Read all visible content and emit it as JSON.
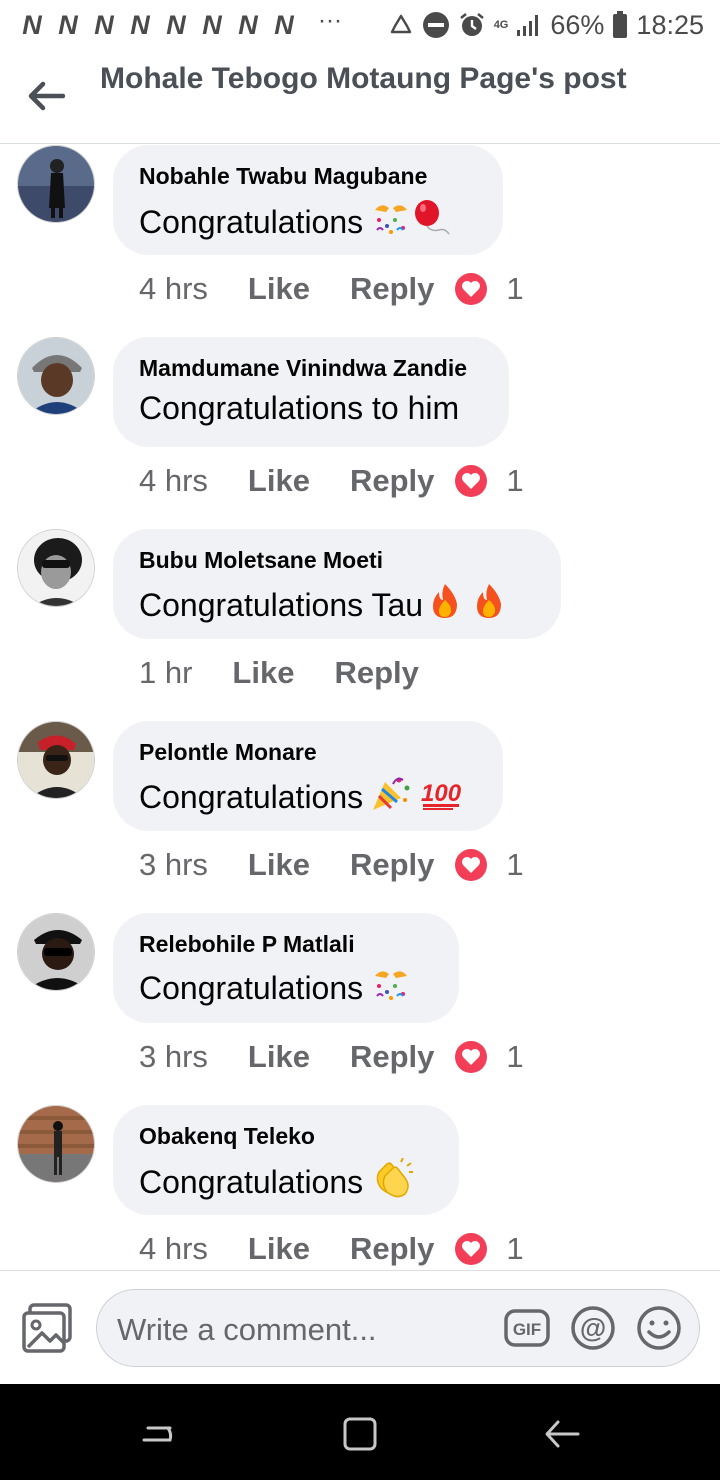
{
  "status_bar": {
    "notif_glyphs": [
      "N",
      "N",
      "N",
      "N",
      "N",
      "N",
      "N",
      "N"
    ],
    "overflow": "···",
    "network": "4G",
    "battery_pct": "66%",
    "time": "18:25",
    "icons": [
      "recycle-icon",
      "do-not-disturb-icon",
      "alarm-icon",
      "network-4g-icon",
      "signal-icon",
      "battery-icon"
    ]
  },
  "header": {
    "back_icon": "arrow-left-icon",
    "title": "Mohale Tebogo Motaung Page's post"
  },
  "comments": [
    {
      "author": "Nobahle Twabu Magubane",
      "text": "Congratulations",
      "emojis": [
        "confetti-icon",
        "balloon-icon"
      ],
      "time": "4 hrs",
      "like": "Like",
      "reply": "Reply",
      "reactions": "1",
      "has_reaction": true
    },
    {
      "author": "Mamdumane Vinindwa Zandie",
      "text": "Congratulations to him",
      "emojis": [],
      "time": "4 hrs",
      "like": "Like",
      "reply": "Reply",
      "reactions": "1",
      "has_reaction": true
    },
    {
      "author": "Bubu Moletsane Moeti",
      "text": "Congratulations Tau",
      "emojis": [
        "fire-icon",
        "fire-icon"
      ],
      "time": "1 hr",
      "like": "Like",
      "reply": "Reply",
      "reactions": "",
      "has_reaction": false
    },
    {
      "author": "Pelontle Monare",
      "text": "Congratulations",
      "emojis": [
        "party-popper-icon",
        "hundred-points-icon"
      ],
      "time": "3 hrs",
      "like": "Like",
      "reply": "Reply",
      "reactions": "1",
      "has_reaction": true
    },
    {
      "author": "Relebohile P Matlali",
      "text": "Congratulations",
      "emojis": [
        "confetti-icon"
      ],
      "time": "3 hrs",
      "like": "Like",
      "reply": "Reply",
      "reactions": "1",
      "has_reaction": true
    },
    {
      "author": "Obakenq Teleko",
      "text": "Congratulations",
      "emojis": [
        "clapping-hands-icon"
      ],
      "time": "4 hrs",
      "like": "Like",
      "reply": "Reply",
      "reactions": "1",
      "has_reaction": true
    }
  ],
  "composer": {
    "placeholder": "Write a comment...",
    "gif_label": "GIF",
    "mention_label": "@",
    "icons": [
      "photo-icon",
      "gif-icon",
      "mention-icon",
      "emoji-icon"
    ]
  },
  "nav_bar": {
    "icons": [
      "recent-apps-icon",
      "home-icon",
      "back-nav-icon"
    ]
  },
  "colors": {
    "bubble": "#f0f2f5",
    "meta_text": "#65676b",
    "heart_reaction": "#f33e58",
    "title_text": "#4b4f56"
  }
}
